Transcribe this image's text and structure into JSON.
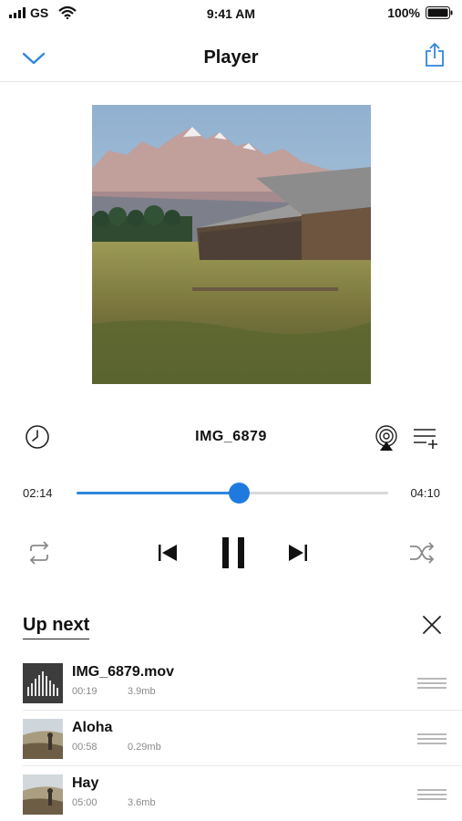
{
  "status_bar": {
    "carrier": "GS",
    "time": "9:41 AM",
    "battery": "100%"
  },
  "nav": {
    "title": "Player",
    "back_icon": "chevron-down-icon",
    "share_icon": "share-icon",
    "accent": "#2f86dd"
  },
  "now_playing": {
    "title": "IMG_6879",
    "elapsed": "02:14",
    "total": "04:10",
    "progress": 0.52
  },
  "controls": {
    "icons": [
      "history-icon",
      "airplay-icon",
      "add-to-queue-icon",
      "repeat-icon",
      "previous-icon",
      "pause-icon",
      "next-icon",
      "shuffle-icon"
    ]
  },
  "up_next": {
    "title": "Up next",
    "items": [
      {
        "title": "IMG_6879.mov",
        "duration": "00:19",
        "size": "3.9mb",
        "thumb": "waveform"
      },
      {
        "title": "Aloha",
        "duration": "00:58",
        "size": "0.29mb",
        "thumb": "landscape"
      },
      {
        "title": "Hay",
        "duration": "05:00",
        "size": "3.6mb",
        "thumb": "landscape"
      }
    ]
  }
}
